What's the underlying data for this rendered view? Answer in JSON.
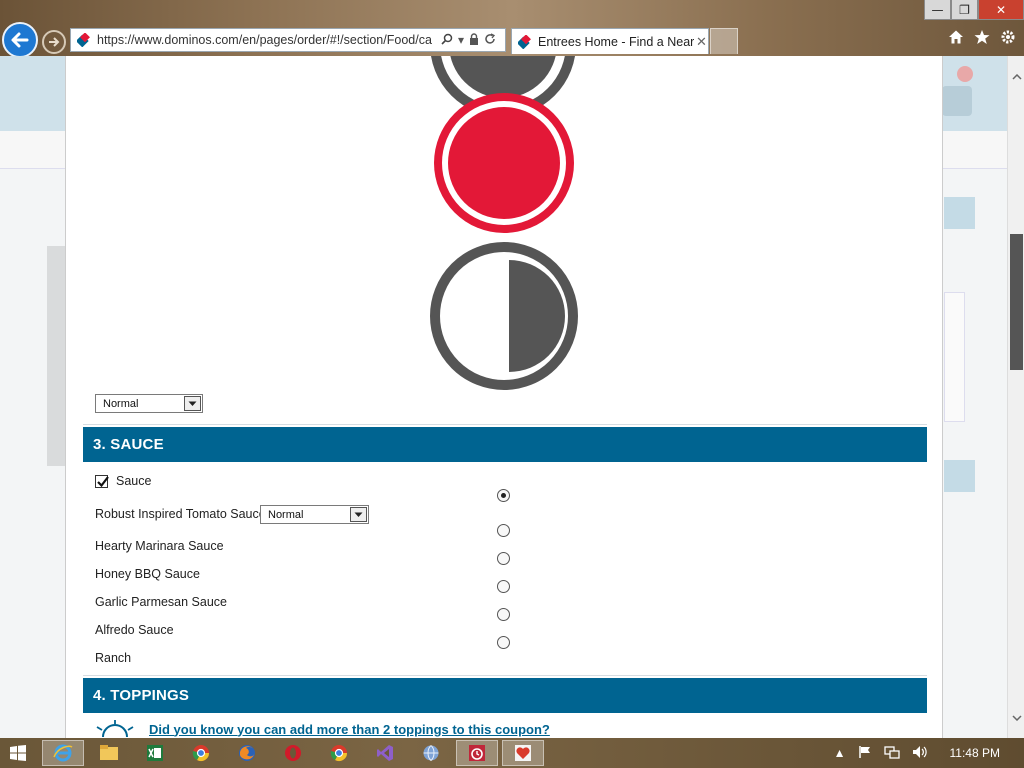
{
  "browser": {
    "url": "https://www.dominos.com/en/pages/order/#!/section/Food/ca",
    "tab_title": "Entrees Home - Find a Near...",
    "tab_close": "✕",
    "window_controls": {
      "minimize": "—",
      "restore": "❐",
      "close": "✕"
    }
  },
  "modal": {
    "sauce_amount_select": "Normal",
    "sauce_section": {
      "title": "3. SAUCE",
      "checkbox_label": "Sauce",
      "checkbox_checked": true,
      "options": [
        {
          "label": "Robust Inspired Tomato Sauce",
          "selected": true,
          "amount": "Normal"
        },
        {
          "label": "Hearty Marinara Sauce",
          "selected": false
        },
        {
          "label": "Honey BBQ Sauce",
          "selected": false
        },
        {
          "label": "Garlic Parmesan Sauce",
          "selected": false
        },
        {
          "label": "Alfredo Sauce",
          "selected": false
        },
        {
          "label": "Ranch",
          "selected": false
        }
      ]
    },
    "toppings_section": {
      "title": "4. TOPPINGS",
      "tip": "Did you know you can add more than 2 toppings to this coupon?"
    }
  },
  "colors": {
    "section_bar": "#006491",
    "selected_circle": "#e31837",
    "unselected_circle": "#555555"
  },
  "taskbar": {
    "time": "11:48 PM"
  }
}
